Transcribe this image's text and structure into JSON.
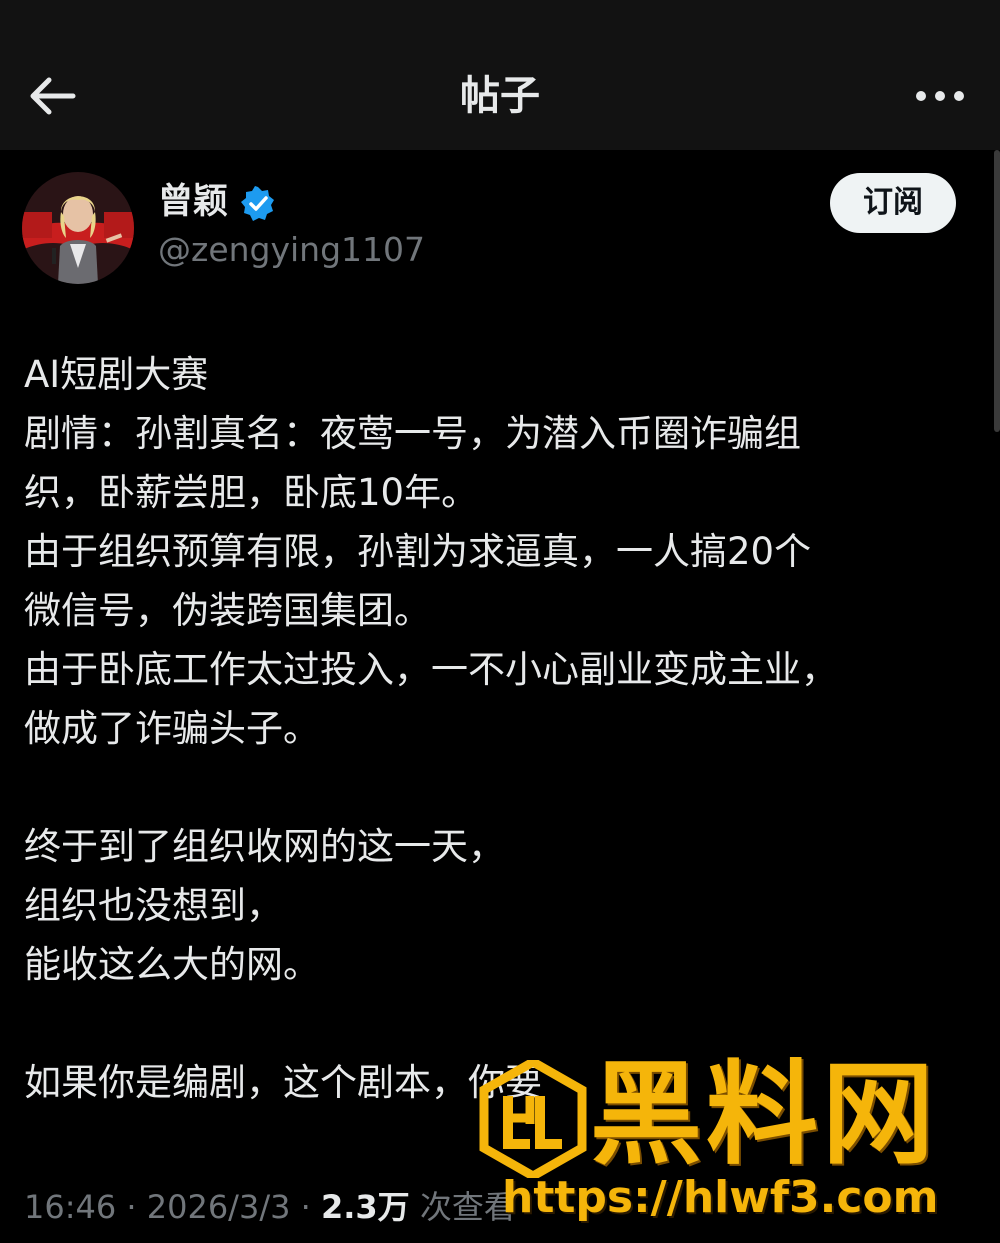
{
  "header": {
    "title": "帖子",
    "back_icon": "arrow-left-icon",
    "more_icon": "more-horizontal-icon"
  },
  "author": {
    "name": "曾颖",
    "handle": "@zengying1107",
    "verified": true,
    "verified_color": "#1d9bf0"
  },
  "subscribe_label": "订阅",
  "post": {
    "lines": [
      "AI短剧大赛",
      "剧情：孙割真名：夜莺一号，为潜入币圈诈骗组",
      "织，卧薪尝胆，卧底10年。",
      "由于组织预算有限，孙割为求逼真，一人搞20个",
      "微信号，伪装跨国集团。",
      "由于卧底工作太过投入，一不小心副业变成主业，",
      "做成了诈骗头子。",
      "",
      "终于到了组织收网的这一天，",
      "组织也没想到，",
      "能收这么大的网。",
      "",
      "如果你是编剧，这个剧本，你要"
    ]
  },
  "meta": {
    "time": "16:46",
    "separator": "·",
    "date": "2026/3/3",
    "views": "2.3万",
    "views_label": "次查看"
  },
  "watermark": {
    "title": "黑料网",
    "url": "https://hlwf3.com",
    "color": "#f5b50a"
  },
  "colors": {
    "background": "#000000",
    "header_bg": "#121212",
    "text_primary": "#e7e9ea",
    "text_secondary": "#71767b"
  }
}
